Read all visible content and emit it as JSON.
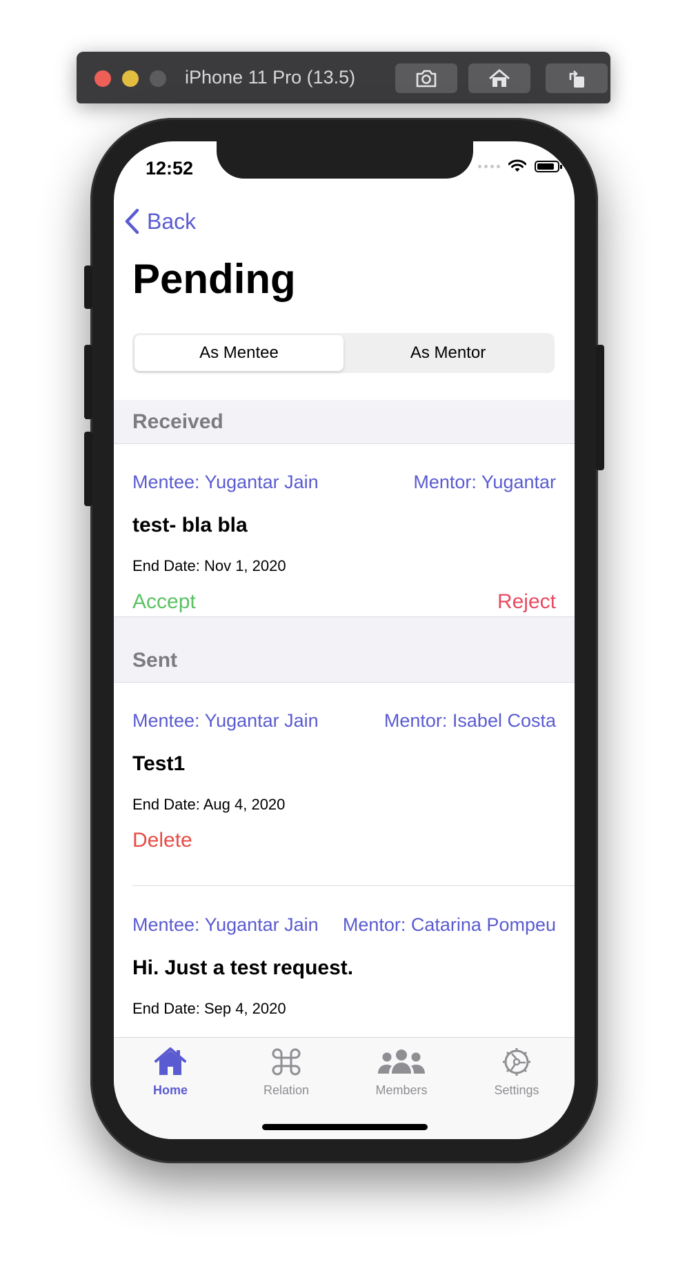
{
  "simulator": {
    "title": "iPhone 11 Pro (13.5)",
    "buttons": [
      "screenshot-icon",
      "home-icon",
      "rotate-icon"
    ]
  },
  "status_bar": {
    "time": "12:52"
  },
  "nav": {
    "back_label": "Back",
    "title": "Pending"
  },
  "segments": {
    "items": [
      "As Mentee",
      "As Mentor"
    ],
    "selected": "As Mentee"
  },
  "sections": {
    "received": {
      "header": "Received",
      "items": [
        {
          "mentee": "Mentee: Yugantar Jain",
          "mentor": "Mentor: Yugantar",
          "title": "test- bla bla",
          "end_date": "End Date: Nov 1, 2020",
          "accept": "Accept",
          "reject": "Reject"
        }
      ]
    },
    "sent": {
      "header": "Sent",
      "items": [
        {
          "mentee": "Mentee: Yugantar Jain",
          "mentor": "Mentor: Isabel Costa",
          "title": "Test1",
          "end_date": "End Date: Aug 4, 2020",
          "delete": "Delete"
        },
        {
          "mentee": "Mentee: Yugantar Jain",
          "mentor": "Mentor: Catarina Pompeu",
          "title": "Hi. Just a test request.",
          "end_date": "End Date: Sep 4, 2020"
        }
      ]
    }
  },
  "tabbar": {
    "items": [
      {
        "label": "Home",
        "icon": "house-icon",
        "active": true
      },
      {
        "label": "Relation",
        "icon": "command-icon",
        "active": false
      },
      {
        "label": "Members",
        "icon": "people-icon",
        "active": false
      },
      {
        "label": "Settings",
        "icon": "gear-icon",
        "active": false
      }
    ]
  },
  "colors": {
    "accent": "#5a5bd0",
    "accept": "#5bc163",
    "reject": "#e74b62",
    "delete": "#e74b45",
    "section_bg": "#f2f2f7",
    "tab_inactive": "#8e8e93"
  }
}
